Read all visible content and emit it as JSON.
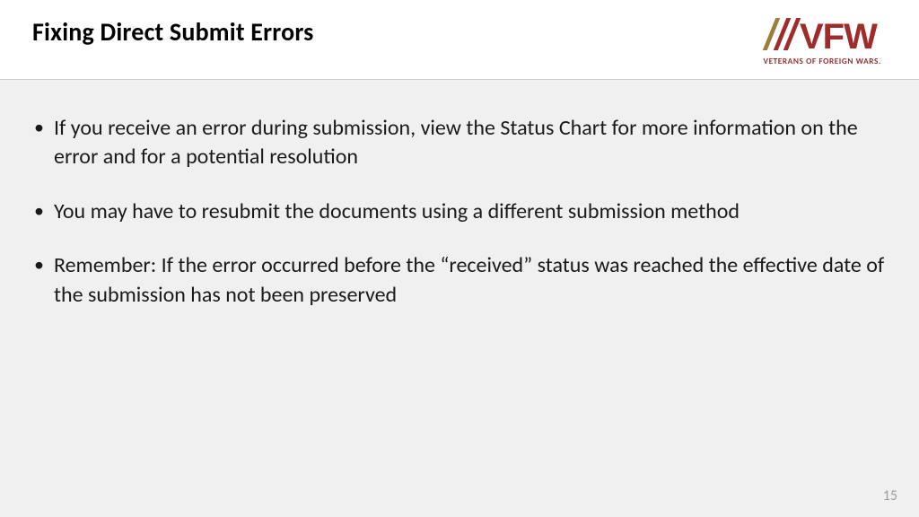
{
  "header": {
    "title": "Fixing Direct Submit Errors",
    "logo": {
      "main_text": "VFW",
      "tagline": "VETERANS OF FOREIGN WARS.",
      "colors": {
        "red": "#a02b2b",
        "gold": "#9a7f3c"
      }
    }
  },
  "content": {
    "bullets": [
      "If you receive an error during submission, view the Status Chart for more information on the error and for a potential resolution",
      "You may have to resubmit the documents using a different submission method",
      "Remember: If the error occurred before the “received” status was reached the effective date of the submission has not been preserved"
    ]
  },
  "footer": {
    "page_number": "15"
  }
}
